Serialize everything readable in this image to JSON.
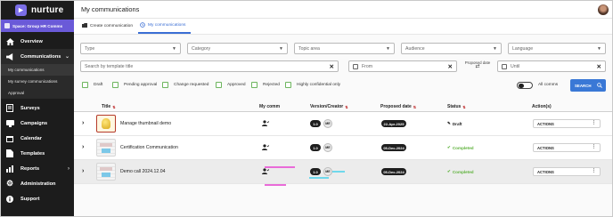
{
  "app": {
    "name": "nurture",
    "space": "Space: Group HR Comms"
  },
  "header": {
    "title": "My communications"
  },
  "sidebar": {
    "items": [
      {
        "label": "Overview",
        "icon": "home-icon"
      },
      {
        "label": "Communications",
        "icon": "megaphone-icon"
      },
      {
        "label": "Surveys",
        "icon": "survey-icon"
      },
      {
        "label": "Campaigns",
        "icon": "campaign-icon"
      },
      {
        "label": "Calendar",
        "icon": "calendar-icon"
      },
      {
        "label": "Templates",
        "icon": "template-icon"
      },
      {
        "label": "Reports",
        "icon": "report-icon"
      },
      {
        "label": "Administration",
        "icon": "gear-icon"
      },
      {
        "label": "Support",
        "icon": "info-icon"
      }
    ],
    "subitems": [
      "My communications",
      "My survey communications",
      "Approval"
    ]
  },
  "tabs": [
    {
      "label": "Create communication",
      "icon": "create-icon"
    },
    {
      "label": "My communications",
      "icon": "history-icon"
    }
  ],
  "filters": {
    "type": "Type",
    "category": "Category",
    "topic": "Topic area",
    "audience": "Audience",
    "language": "Language",
    "search_placeholder": "Search by template title",
    "from": "From",
    "proposed_date": "Proposed date",
    "until": "Until",
    "checkboxes": [
      "Draft",
      "Pending approval",
      "Change requested",
      "Approved",
      "Rejected",
      "Highly confidential only"
    ],
    "all_comms": "All comms",
    "search_button": "SEARCH"
  },
  "table": {
    "headers": [
      "Title",
      "My comm",
      "Version/Creator",
      "Proposed date",
      "Status",
      "Action(s)"
    ],
    "rows": [
      {
        "title": "Manage thumbnail demo",
        "version": "1.0",
        "creator": "ME",
        "date": "22-Apr-2025",
        "status": "Draft",
        "actions": "ACTIONS"
      },
      {
        "title": "Certification Communication",
        "version": "1.0",
        "creator": "ME",
        "date": "05-Dec-2024",
        "status": "Completed",
        "actions": "ACTIONS"
      },
      {
        "title": "Demo call 2024.12.04",
        "version": "1.0",
        "creator": "ME",
        "date": "05-Dec-2024",
        "status": "Completed",
        "actions": "ACTIONS"
      }
    ]
  },
  "colors": {
    "brand": "#6a5ad8",
    "primary": "#3a78d6",
    "success": "#5fb23c",
    "sidebar": "#1c1c1c"
  }
}
